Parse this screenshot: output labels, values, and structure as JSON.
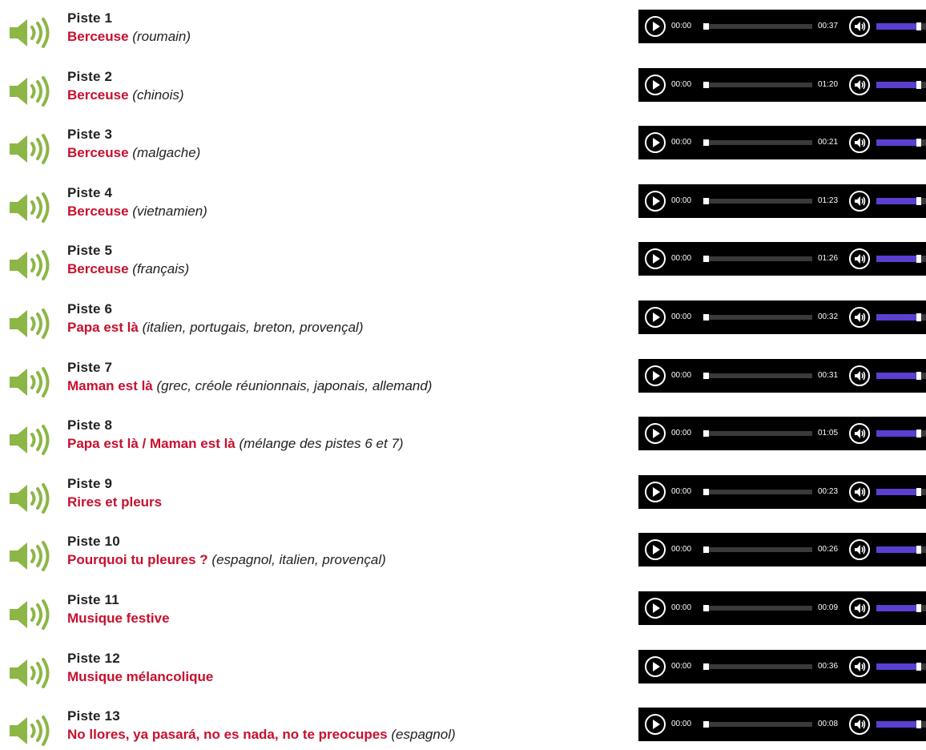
{
  "colors": {
    "title_red": "#c8102e",
    "speaker_green": "#8cb646",
    "volume_purple": "#5b3fd1",
    "player_bg": "#000000"
  },
  "icons": {
    "row_icon": "speaker-icon",
    "play": "play-icon",
    "volume": "volume-icon"
  },
  "tracks": [
    {
      "number": "Piste 1",
      "title": "Berceuse",
      "lang": "(roumain)",
      "current": "00:00",
      "duration": "00:37",
      "progress": 0.0,
      "volume": 0.9
    },
    {
      "number": "Piste 2",
      "title": "Berceuse",
      "lang": "(chinois)",
      "current": "00:00",
      "duration": "01:20",
      "progress": 0.0,
      "volume": 0.9
    },
    {
      "number": "Piste 3",
      "title": "Berceuse",
      "lang": "(malgache)",
      "current": "00:00",
      "duration": "00:21",
      "progress": 0.0,
      "volume": 0.9
    },
    {
      "number": "Piste 4",
      "title": "Berceuse",
      "lang": "(vietnamien)",
      "current": "00:00",
      "duration": "01:23",
      "progress": 0.0,
      "volume": 0.9
    },
    {
      "number": "Piste 5",
      "title": "Berceuse",
      "lang": "(français)",
      "current": "00:00",
      "duration": "01:26",
      "progress": 0.0,
      "volume": 0.9
    },
    {
      "number": "Piste 6",
      "title": "Papa est là",
      "lang": "(italien, portugais, breton, provençal)",
      "current": "00:00",
      "duration": "00:32",
      "progress": 0.0,
      "volume": 0.9
    },
    {
      "number": "Piste 7",
      "title": "Maman est là",
      "lang": "(grec, créole réunionnais, japonais, allemand)",
      "current": "00:00",
      "duration": "00:31",
      "progress": 0.0,
      "volume": 0.9
    },
    {
      "number": "Piste 8",
      "title": "Papa est là / Maman est là",
      "lang": "(mélange des pistes 6 et 7)",
      "current": "00:00",
      "duration": "01:05",
      "progress": 0.0,
      "volume": 0.9
    },
    {
      "number": "Piste 9",
      "title": "Rires et pleurs",
      "lang": "",
      "current": "00:00",
      "duration": "00:23",
      "progress": 0.0,
      "volume": 0.9
    },
    {
      "number": "Piste 10",
      "title": "Pourquoi tu pleures ?",
      "lang": "(espagnol, italien, provençal)",
      "current": "00:00",
      "duration": "00:26",
      "progress": 0.0,
      "volume": 0.9
    },
    {
      "number": "Piste 11",
      "title": "Musique festive",
      "lang": "",
      "current": "00:00",
      "duration": "00:09",
      "progress": 0.0,
      "volume": 0.9
    },
    {
      "number": "Piste 12",
      "title": "Musique mélancolique",
      "lang": "",
      "current": "00:00",
      "duration": "00:36",
      "progress": 0.0,
      "volume": 0.9
    },
    {
      "number": "Piste 13",
      "title": "No llores, ya pasará, no es nada, no te preocupes",
      "lang": "(espagnol)",
      "current": "00:00",
      "duration": "00:08",
      "progress": 0.0,
      "volume": 0.9
    }
  ]
}
